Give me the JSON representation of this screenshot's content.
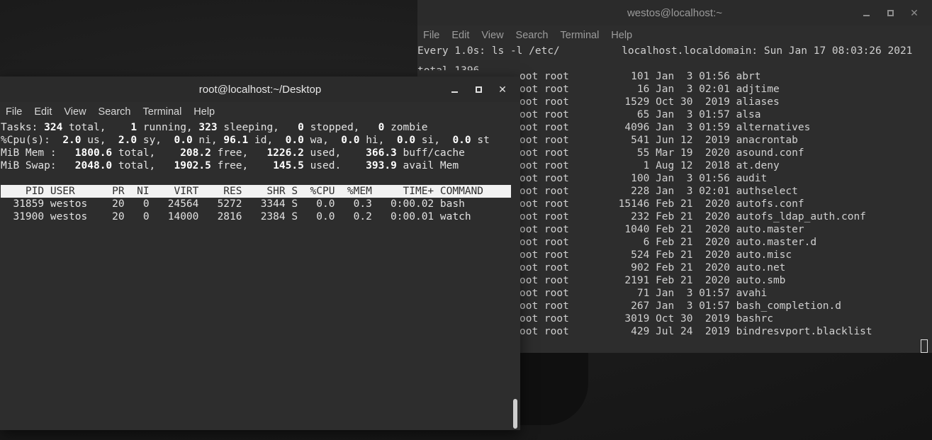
{
  "back_window": {
    "title": "westos@localhost:~",
    "menu": [
      "File",
      "Edit",
      "View",
      "Search",
      "Terminal",
      "Help"
    ],
    "watch_header_left": "Every 1.0s: ls -l /etc/",
    "watch_header_right": "localhost.localdomain: Sun Jan 17 08:03:26 2021",
    "total_line_partial": "total 1396",
    "ls_rows": [
      {
        "prefix": "oot root",
        "size": "101",
        "date": "Jan  3 01:56",
        "name": "abrt"
      },
      {
        "prefix": "oot root",
        "size": "16",
        "date": "Jan  3 02:01",
        "name": "adjtime"
      },
      {
        "prefix": "oot root",
        "size": "1529",
        "date": "Oct 30  2019",
        "name": "aliases"
      },
      {
        "prefix": "oot root",
        "size": "65",
        "date": "Jan  3 01:57",
        "name": "alsa"
      },
      {
        "prefix": "oot root",
        "size": "4096",
        "date": "Jan  3 01:59",
        "name": "alternatives"
      },
      {
        "prefix": "oot root",
        "size": "541",
        "date": "Jun 12  2019",
        "name": "anacrontab"
      },
      {
        "prefix": "oot root",
        "size": "55",
        "date": "Mar 19  2020",
        "name": "asound.conf"
      },
      {
        "prefix": "oot root",
        "size": "1",
        "date": "Aug 12  2018",
        "name": "at.deny"
      },
      {
        "prefix": "oot root",
        "size": "100",
        "date": "Jan  3 01:56",
        "name": "audit"
      },
      {
        "prefix": "oot root",
        "size": "228",
        "date": "Jan  3 02:01",
        "name": "authselect"
      },
      {
        "prefix": "oot root",
        "size": "15146",
        "date": "Feb 21  2020",
        "name": "autofs.conf"
      },
      {
        "prefix": "oot root",
        "size": "232",
        "date": "Feb 21  2020",
        "name": "autofs_ldap_auth.conf"
      },
      {
        "prefix": "oot root",
        "size": "1040",
        "date": "Feb 21  2020",
        "name": "auto.master"
      },
      {
        "prefix": "oot root",
        "size": "6",
        "date": "Feb 21  2020",
        "name": "auto.master.d"
      },
      {
        "prefix": "oot root",
        "size": "524",
        "date": "Feb 21  2020",
        "name": "auto.misc"
      },
      {
        "prefix": "oot root",
        "size": "902",
        "date": "Feb 21  2020",
        "name": "auto.net"
      },
      {
        "prefix": "oot root",
        "size": "2191",
        "date": "Feb 21  2020",
        "name": "auto.smb"
      },
      {
        "prefix": "oot root",
        "size": "71",
        "date": "Jan  3 01:57",
        "name": "avahi"
      },
      {
        "prefix": "oot root",
        "size": "267",
        "date": "Jan  3 01:57",
        "name": "bash_completion.d"
      },
      {
        "prefix": "oot root",
        "size": "3019",
        "date": "Oct 30  2019",
        "name": "bashrc"
      },
      {
        "prefix": "oot root",
        "size": "429",
        "date": "Jul 24  2019",
        "name": "bindresvport.blacklist"
      }
    ]
  },
  "front_window": {
    "title": "root@localhost:~/Desktop",
    "menu": [
      "File",
      "Edit",
      "View",
      "Search",
      "Terminal",
      "Help"
    ],
    "top": {
      "tasks": {
        "label": "Tasks:",
        "total": "324",
        "running": "1",
        "sleeping": "323",
        "stopped": "0",
        "zombie": "0"
      },
      "cpu": {
        "label": "%Cpu(s):",
        "us": "2.0",
        "sy": "2.0",
        "ni": "0.0",
        "id": "96.1",
        "wa": "0.0",
        "hi": "0.0",
        "si": "0.0",
        "st": "0.0"
      },
      "mem": {
        "label": "MiB Mem :",
        "total": "1800.6",
        "free": "208.2",
        "used": "1226.2",
        "buff_cache": "366.3"
      },
      "swap": {
        "label": "MiB Swap:",
        "total": "2048.0",
        "free": "1902.5",
        "used": "145.5",
        "avail": "393.9"
      },
      "columns": [
        "PID",
        "USER",
        "PR",
        "NI",
        "VIRT",
        "RES",
        "SHR",
        "S",
        "%CPU",
        "%MEM",
        "TIME+",
        "COMMAND"
      ],
      "processes": [
        {
          "pid": "31859",
          "user": "westos",
          "pr": "20",
          "ni": "0",
          "virt": "24564",
          "res": "5272",
          "shr": "3344",
          "s": "S",
          "cpu": "0.0",
          "mem": "0.3",
          "time": "0:00.02",
          "cmd": "bash"
        },
        {
          "pid": "31900",
          "user": "westos",
          "pr": "20",
          "ni": "0",
          "virt": "14000",
          "res": "2816",
          "shr": "2384",
          "s": "S",
          "cpu": "0.0",
          "mem": "0.2",
          "time": "0:00.01",
          "cmd": "watch"
        }
      ]
    }
  }
}
